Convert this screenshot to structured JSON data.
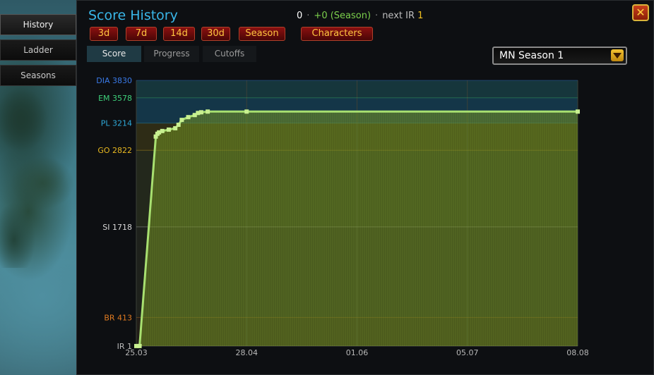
{
  "side_tabs": [
    {
      "label": "History",
      "active": true
    },
    {
      "label": "Ladder",
      "active": false
    },
    {
      "label": "Seasons",
      "active": false
    }
  ],
  "header": {
    "title": "Score History",
    "score": "0",
    "delta": "+0 (Season)",
    "next_label": "next IR",
    "next_value": "1",
    "close_icon": "close-icon"
  },
  "range_buttons": [
    {
      "label": "3d"
    },
    {
      "label": "7d"
    },
    {
      "label": "14d"
    },
    {
      "label": "30d"
    },
    {
      "label": "Season"
    }
  ],
  "characters_button": "Characters",
  "sub_tabs": [
    {
      "label": "Score",
      "active": true
    },
    {
      "label": "Progress",
      "active": false
    },
    {
      "label": "Cutoffs",
      "active": false
    }
  ],
  "season_select": {
    "value": "MN Season 1",
    "icon": "chevron-down-icon"
  },
  "colors": {
    "title": "#39b6e8",
    "line": "#a8e070",
    "fill": "#6e8a20",
    "range_button_text": "#ffc640",
    "delta": "#7cd04c",
    "next_value": "#f0c020"
  },
  "chart_data": {
    "type": "area",
    "ylim": [
      0,
      3830
    ],
    "y_ticks": [
      {
        "label": "DIA 3830",
        "value": 3830,
        "color": "#3a7ae8"
      },
      {
        "label": "EM 3578",
        "value": 3578,
        "color": "#3ed07a"
      },
      {
        "label": "PL 3214",
        "value": 3214,
        "color": "#2ea8d8"
      },
      {
        "label": "GO 2822",
        "value": 2822,
        "color": "#e8b820"
      },
      {
        "label": "SI 1718",
        "value": 1718,
        "color": "#d8d8d8"
      },
      {
        "label": "BR 413",
        "value": 413,
        "color": "#e07a20"
      },
      {
        "label": "IR 1",
        "value": 1,
        "color": "#b8b8b8"
      }
    ],
    "x_ticks": [
      {
        "label": "25.03",
        "day": 0
      },
      {
        "label": "28.04",
        "day": 34
      },
      {
        "label": "01.06",
        "day": 68
      },
      {
        "label": "05.07",
        "day": 102
      },
      {
        "label": "08.08",
        "day": 136
      }
    ],
    "series": [
      {
        "x": [
          0,
          1,
          6,
          6.5,
          7,
          8,
          10,
          12,
          13,
          14,
          16,
          18,
          19,
          20,
          22,
          34,
          136
        ],
        "y": [
          1,
          1,
          3020,
          3060,
          3080,
          3100,
          3120,
          3140,
          3190,
          3260,
          3300,
          3330,
          3360,
          3370,
          3380,
          3380,
          3380
        ]
      }
    ]
  }
}
